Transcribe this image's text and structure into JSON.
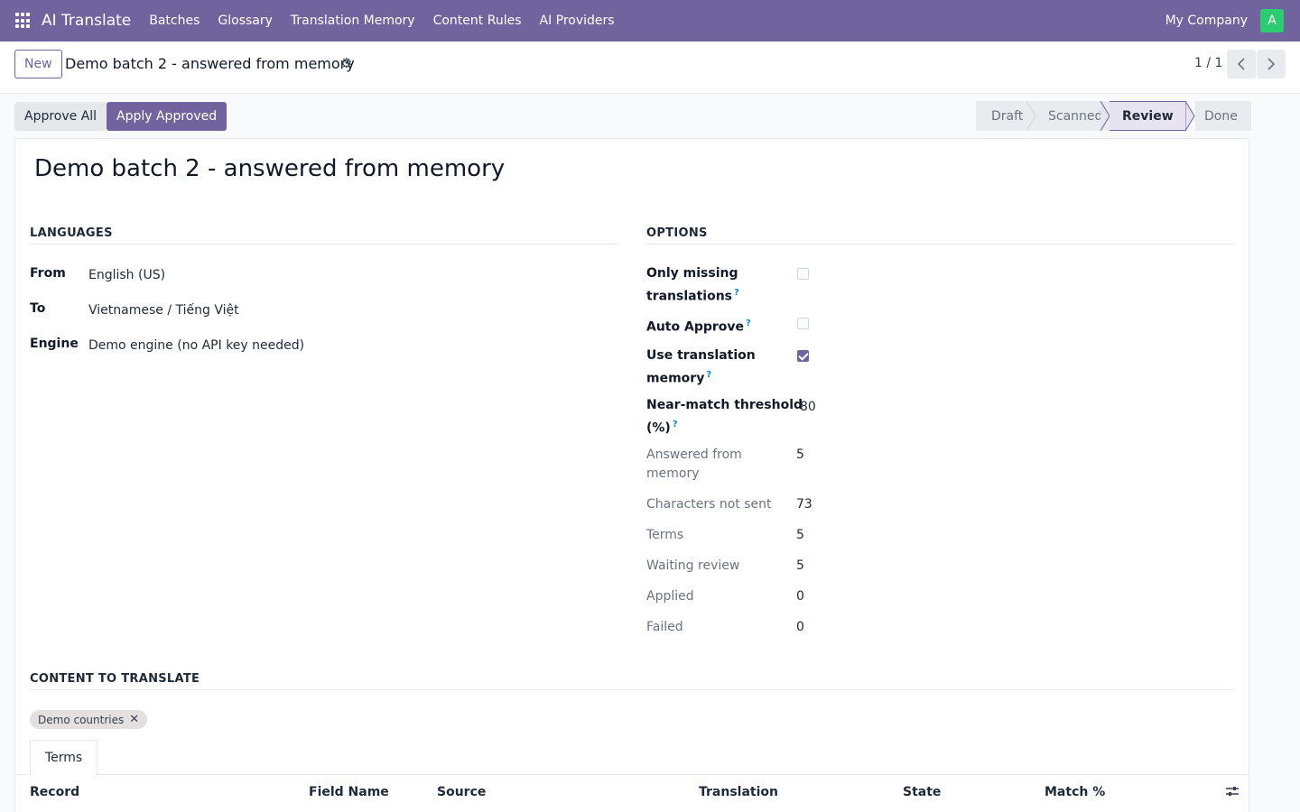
{
  "navbar": {
    "app_name": "AI Translate",
    "menu": [
      "Batches",
      "Glossary",
      "Translation Memory",
      "Content Rules",
      "AI Providers"
    ],
    "company": "My Company",
    "avatar_letter": "A"
  },
  "control_panel": {
    "new_label": "New",
    "record_title": "Demo batch 2 - answered from memory",
    "pager": "1 / 1"
  },
  "actions": {
    "approve_all": "Approve All",
    "apply_approved": "Apply Approved"
  },
  "statusbar": {
    "stages": [
      "Draft",
      "Scanned",
      "Review",
      "Done"
    ],
    "active": "Review"
  },
  "form": {
    "title": "Demo batch 2 - answered from memory",
    "languages": {
      "heading": "LANGUAGES",
      "from_label": "From",
      "from_value": "English (US)",
      "to_label": "To",
      "to_value": "Vietnamese / Tiếng Việt",
      "engine_label": "Engine",
      "engine_value": "Demo engine (no API key needed)"
    },
    "options": {
      "heading": "OPTIONS",
      "only_missing_l1": "Only missing",
      "only_missing_l2": "translations",
      "only_missing_checked": false,
      "auto_approve": "Auto Approve",
      "auto_approve_checked": false,
      "use_tm_l1": "Use translation",
      "use_tm_l2": "memory",
      "use_tm_checked": true,
      "near_match_l1": "Near-match threshold",
      "near_match_l2": "(%)",
      "near_match_value": "80",
      "answered_l1": "Answered from",
      "answered_l2": "memory",
      "answered_value": "5",
      "chars_not_sent_label": "Characters not sent",
      "chars_not_sent_value": "73",
      "terms_label": "Terms",
      "terms_value": "5",
      "waiting_label": "Waiting review",
      "waiting_value": "5",
      "applied_label": "Applied",
      "applied_value": "0",
      "failed_label": "Failed",
      "failed_value": "0",
      "help_mark": "?"
    },
    "content": {
      "heading": "CONTENT TO TRANSLATE",
      "tag": "Demo countries",
      "tag_remove": "✕"
    },
    "tabs": [
      "Terms"
    ],
    "table_headers": [
      "Record",
      "Field Name",
      "Source",
      "Translation",
      "State",
      "Match %"
    ]
  },
  "icons": {
    "apps": "apps-grid-icon",
    "gear": "gear-icon",
    "prev": "chevron-left-icon",
    "next": "chevron-right-icon",
    "settings": "sliders-icon"
  },
  "colors": {
    "brand": "#71639e",
    "avatar": "#2ecc71",
    "help": "#0e86d4"
  }
}
